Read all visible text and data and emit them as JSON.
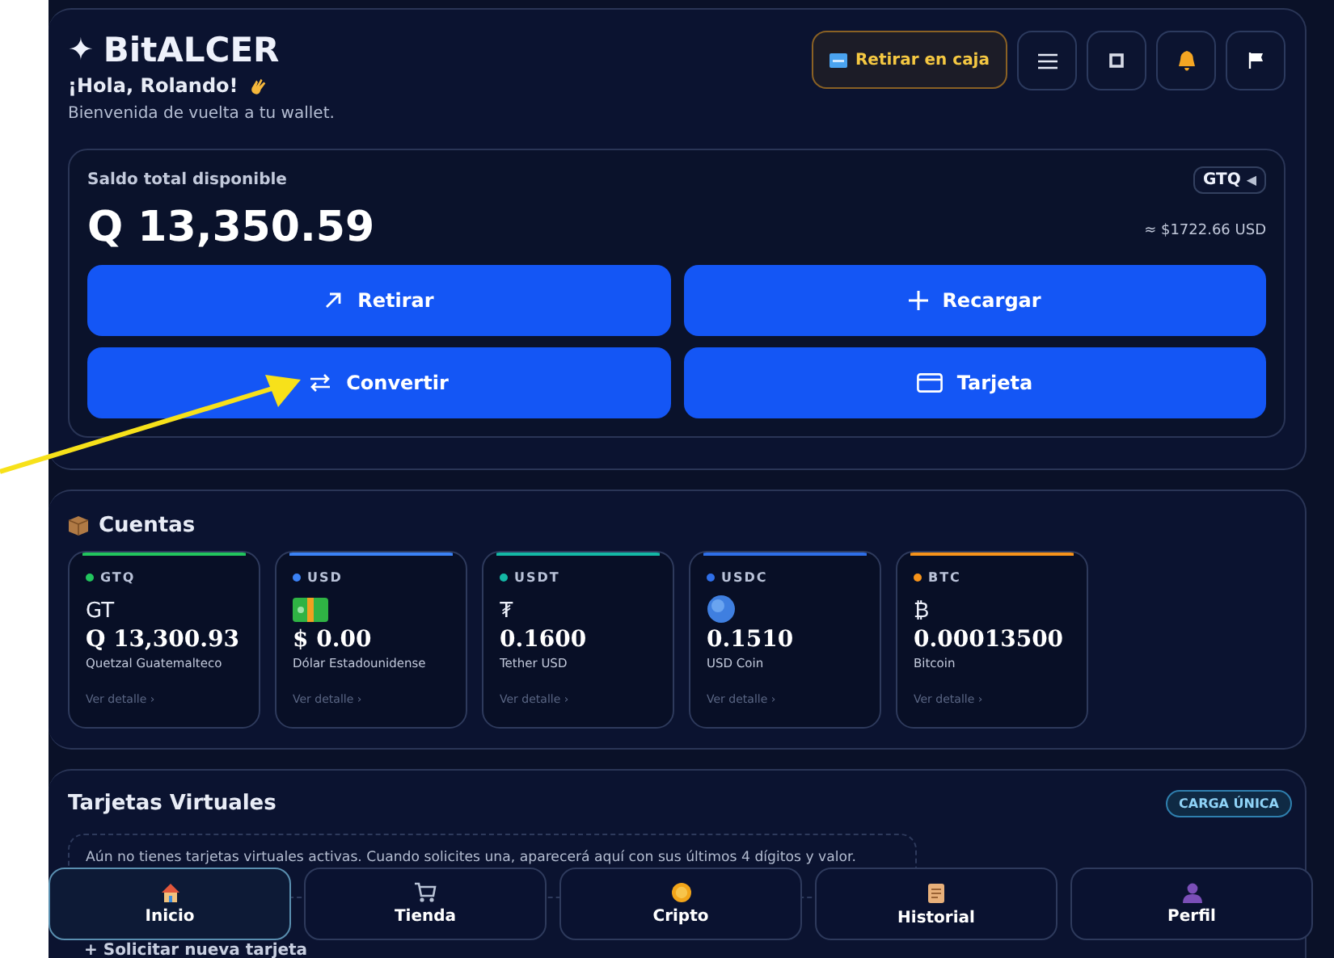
{
  "header": {
    "logo_mark": "✦",
    "brand": "BitALCER",
    "greeting": "¡Hola, Rolando!",
    "subtitle": "Bienvenida de vuelta a tu wallet.",
    "cash_button": "Retirar en caja"
  },
  "balance": {
    "label": "Saldo total disponible",
    "currency": "GTQ",
    "currency_caret": "◀",
    "amount": "Q 13,350.59",
    "usd_equiv": "≈ $1722.66 USD",
    "actions": [
      {
        "label": "Retirar"
      },
      {
        "label": "Recargar"
      },
      {
        "label": "Convertir"
      },
      {
        "label": "Tarjeta"
      }
    ]
  },
  "accounts": {
    "title": "Cuentas",
    "items": [
      {
        "code": "GTQ",
        "color": "#22c55e",
        "kind": "symbol",
        "symbol": "GT",
        "amount": "Q 13,300.93",
        "name": "Quetzal Guatemalteco",
        "link": "Ver detalle ›"
      },
      {
        "code": "USD",
        "color": "#3b82f6",
        "kind": "icon",
        "amount": "$ 0.00",
        "name": "Dólar Estadounidense",
        "link": "Ver detalle ›"
      },
      {
        "code": "USDT",
        "color": "#14b8a6",
        "kind": "symbol",
        "symbol": "₮",
        "amount": "0.1600",
        "name": "Tether USD",
        "link": "Ver detalle ›"
      },
      {
        "code": "USDC",
        "color": "#2f6fe8",
        "kind": "icon",
        "amount": "0.1510",
        "name": "USD Coin",
        "link": "Ver detalle ›"
      },
      {
        "code": "BTC",
        "color": "#f7931a",
        "kind": "symbol",
        "symbol": "₿",
        "amount": "0.00013500",
        "name": "Bitcoin",
        "link": "Ver detalle ›"
      }
    ]
  },
  "virtual_cards": {
    "title": "Tarjetas Virtuales",
    "badge": "CARGA ÚNICA",
    "empty_text": "Aún no tienes tarjetas virtuales activas. Cuando solicites una, aparecerá aquí con sus últimos 4 dígitos y valor.",
    "request_button": "+ Solicitar nueva tarjeta"
  },
  "bottom_nav": [
    {
      "label": "Inicio",
      "selected": true
    },
    {
      "label": "Tienda",
      "selected": false
    },
    {
      "label": "Cripto",
      "selected": false
    },
    {
      "label": "Historial",
      "selected": false
    },
    {
      "label": "Perfil",
      "selected": false
    }
  ]
}
